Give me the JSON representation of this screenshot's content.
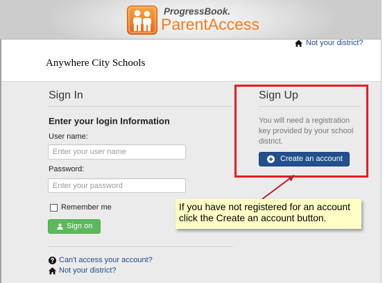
{
  "header": {
    "brand_top": "ProgressBook.",
    "brand_main": "ParentAccess"
  },
  "district_bar": {
    "not_your_district_link": "Not your district?",
    "district_name": "Anywhere City Schools"
  },
  "sign_in": {
    "title": "Sign In",
    "subtitle": "Enter your login Information",
    "username_label": "User name:",
    "username_placeholder": "Enter your user name",
    "username_value": "",
    "password_label": "Password:",
    "password_placeholder": "Enter your password",
    "password_value": "",
    "remember_me_label": "Remember me",
    "remember_me_checked": false,
    "sign_on_button": "Sign on",
    "cant_access_link": "Can't access your account?",
    "not_your_district_link": "Not your district?"
  },
  "sign_up": {
    "title": "Sign Up",
    "description_lines": [
      "You will need a registration",
      "key provided by your school",
      "district."
    ],
    "create_account_button": "Create an account"
  },
  "annotation": {
    "callout_lines": [
      "If you have not registered for an account",
      "click the Create an account button."
    ]
  },
  "icons": {
    "logo": "family-icon",
    "district_link": "home-icon",
    "cant_access": "question-circle-icon",
    "not_your_district": "home-icon",
    "sign_on": "user-icon",
    "create_account": "plus-circle-icon"
  },
  "colors": {
    "brand_orange": "#f47b20",
    "link_blue": "#1c4b8a",
    "sign_on_green": "#5cb85c",
    "create_account_blue": "#22508e",
    "annotation_red": "#e31e24",
    "callout_yellow": "#ffffc6"
  }
}
